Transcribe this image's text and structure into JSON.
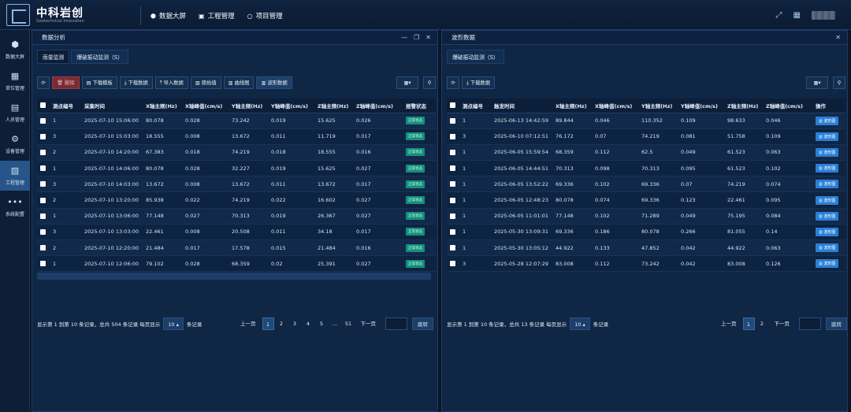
{
  "header": {
    "brand": "中科岩创",
    "brand_sub": "Geotechnical Innovation",
    "nav": [
      {
        "icon": "⬢",
        "label": "数据大屏"
      },
      {
        "icon": "▣",
        "label": "工程管理"
      },
      {
        "icon": "○",
        "label": "项目管理"
      }
    ],
    "icons": [
      "fullscreen-icon",
      "screen-icon"
    ]
  },
  "sidebar": [
    {
      "icon": "⬢",
      "label": "数据大屏"
    },
    {
      "icon": "▦",
      "label": "单位管理"
    },
    {
      "icon": "▤",
      "label": "人员管理"
    },
    {
      "icon": "⚙",
      "label": "设备管理"
    },
    {
      "icon": "▨",
      "label": "工程管理",
      "active": true
    },
    {
      "icon": "•••",
      "label": "系统配置"
    }
  ],
  "left": {
    "title": "数据分析",
    "ctrls": {
      "min": "—",
      "restore": "❐",
      "close": "✕"
    },
    "tabs": [
      "雨量监测",
      "爆破振动监测（S）"
    ],
    "toolbar": {
      "refresh": "⟳",
      "delete": "删除",
      "delete_icon": "🗑",
      "dl_template": "下载模板",
      "dl_template_icon": "▤",
      "dl_data": "下载数据",
      "dl_data_icon": "⤓",
      "import": "导入数据",
      "import_icon": "⤒",
      "raw": "原始值",
      "raw_icon": "▥",
      "curve": "曲线图",
      "curve_icon": "▥",
      "wave": "波形数据",
      "wave_icon": "▥"
    },
    "grid_btn": "▦▾",
    "search_btn": "⚲",
    "columns": [
      "",
      "测点编号",
      "采集时间",
      "X轴主频(Hz)",
      "X轴峰值(cm/s)",
      "Y轴主频(Hz)",
      "Y轴峰值(cm/s)",
      "Z轴主频(Hz)",
      "Z轴峰值(cm/s)",
      "报警状态"
    ],
    "rows": [
      [
        "1",
        "2025-07-10 15:06:00",
        "80.078",
        "0.028",
        "73.242",
        "0.019",
        "15.625",
        "0.026",
        "正常状态"
      ],
      [
        "3",
        "2025-07-10 15:03:00",
        "18.555",
        "0.008",
        "13.672",
        "0.011",
        "11.719",
        "0.017",
        "正常状态"
      ],
      [
        "2",
        "2025-07-10 14:20:00",
        "67.383",
        "0.018",
        "74.219",
        "0.018",
        "18.555",
        "0.016",
        "正常状态"
      ],
      [
        "1",
        "2025-07-10 14:06:00",
        "80.078",
        "0.028",
        "32.227",
        "0.019",
        "15.625",
        "0.027",
        "正常状态"
      ],
      [
        "3",
        "2025-07-10 14:03:00",
        "13.672",
        "0.008",
        "13.672",
        "0.011",
        "13.672",
        "0.017",
        "正常状态"
      ],
      [
        "2",
        "2025-07-10 13:20:00",
        "85.938",
        "0.022",
        "74.219",
        "0.022",
        "16.602",
        "0.027",
        "正常状态"
      ],
      [
        "1",
        "2025-07-10 13:06:00",
        "77.148",
        "0.027",
        "70.313",
        "0.019",
        "26.367",
        "0.027",
        "正常状态"
      ],
      [
        "3",
        "2025-07-10 13:03:00",
        "22.461",
        "0.008",
        "20.508",
        "0.011",
        "34.18",
        "0.017",
        "正常状态"
      ],
      [
        "2",
        "2025-07-10 12:20:00",
        "21.484",
        "0.017",
        "17.578",
        "0.015",
        "21.484",
        "0.016",
        "正常状态"
      ],
      [
        "1",
        "2025-07-10 12:06:00",
        "79.102",
        "0.028",
        "68.359",
        "0.02",
        "25.391",
        "0.027",
        "正常状态"
      ]
    ],
    "pager": {
      "info": "显示第 1 到第 10 条记录，总共 504 条记录 每页显示",
      "size": "10 ▴",
      "unit": "条记录",
      "prev": "上一页",
      "pages": [
        "1",
        "2",
        "3",
        "4",
        "5",
        "...",
        "51"
      ],
      "next": "下一页",
      "go": "跳转"
    }
  },
  "right": {
    "title": "波形数据",
    "ctrls": {
      "close": "✕"
    },
    "tabs": [
      "爆破振动监测（S）"
    ],
    "toolbar": {
      "refresh": "⟳",
      "dl_data": "下载数据",
      "dl_data_icon": "⤓"
    },
    "grid_btn": "▦▾",
    "search_btn": "⚲",
    "columns": [
      "",
      "测点编号",
      "触发时间",
      "X轴主频(Hz)",
      "X轴峰值(cm/s)",
      "Y轴主频(Hz)",
      "Y轴峰值(cm/s)",
      "Z轴主频(Hz)",
      "Z轴峰值(cm/s)",
      "操作"
    ],
    "rows": [
      [
        "1",
        "2025-06-13 14:42:59",
        "89.844",
        "0.046",
        "110.352",
        "0.109",
        "98.633",
        "0.046",
        "▥ 波形图"
      ],
      [
        "3",
        "2025-06-10 07:12:51",
        "76.172",
        "0.07",
        "74.219",
        "0.081",
        "51.758",
        "0.109",
        "▥ 波形图"
      ],
      [
        "1",
        "2025-06-05 15:59:54",
        "68.359",
        "0.112",
        "62.5",
        "0.049",
        "61.523",
        "0.063",
        "▥ 波形图"
      ],
      [
        "1",
        "2025-06-05 14:44:51",
        "70.313",
        "0.098",
        "70.313",
        "0.095",
        "61.523",
        "0.102",
        "▥ 波形图"
      ],
      [
        "1",
        "2025-06-05 13:52:22",
        "69.336",
        "0.102",
        "69.336",
        "0.07",
        "74.219",
        "0.074",
        "▥ 波形图"
      ],
      [
        "1",
        "2025-06-05 12:48:23",
        "80.078",
        "0.074",
        "69.336",
        "0.123",
        "22.461",
        "0.095",
        "▥ 波形图"
      ],
      [
        "1",
        "2025-06-05 11:01:01",
        "77.148",
        "0.102",
        "71.289",
        "0.049",
        "75.195",
        "0.084",
        "▥ 波形图"
      ],
      [
        "1",
        "2025-05-30 13:09:31",
        "69.336",
        "0.186",
        "80.078",
        "0.266",
        "81.055",
        "0.14",
        "▥ 波形图"
      ],
      [
        "1",
        "2025-05-30 13:05:12",
        "44.922",
        "0.133",
        "47.852",
        "0.042",
        "44.922",
        "0.063",
        "▥ 波形图"
      ],
      [
        "3",
        "2025-05-28 12:07:29",
        "83.008",
        "0.112",
        "73.242",
        "0.042",
        "83.008",
        "0.126",
        "▥ 波形图"
      ]
    ],
    "pager": {
      "info": "显示第 1 到第 10 条记录，总共 13 条记录 每页显示",
      "size": "10 ▴",
      "unit": "条记录",
      "prev": "上一页",
      "pages": [
        "1",
        "2"
      ],
      "next": "下一页",
      "go": "跳转"
    }
  }
}
